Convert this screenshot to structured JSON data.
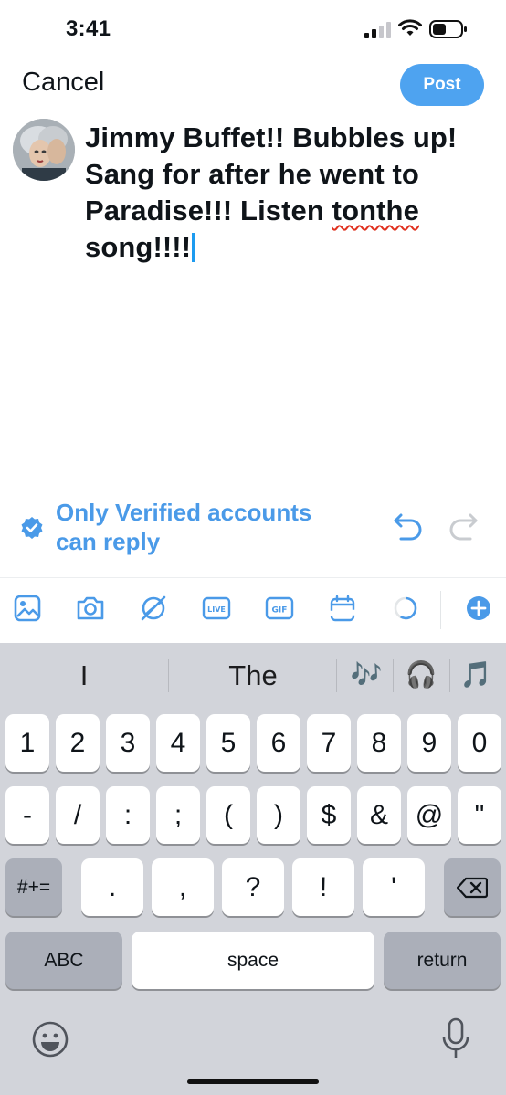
{
  "status_bar": {
    "time": "3:41"
  },
  "header": {
    "cancel_label": "Cancel",
    "post_label": "Post"
  },
  "composer": {
    "text_part1": "Jimmy Buffet!! Bubbles up! Sang for after he went to Paradise!!! Listen ",
    "misspelled_word": "tonthe",
    "text_part2": " song!!!!"
  },
  "reply_setting": {
    "label_line1": "Only Verified accounts",
    "label_line2": "can reply"
  },
  "toolbar": {
    "icons": [
      "image-icon",
      "camera-icon",
      "gif-search-icon",
      "live-icon",
      "gif-icon",
      "schedule-icon",
      "character-count-icon",
      "add-post-icon"
    ],
    "live_label": "LIVE",
    "gif_label": "GIF"
  },
  "keyboard": {
    "suggestions": [
      "I",
      "The",
      "🎶",
      "🎧",
      "🎵"
    ],
    "row1": [
      "1",
      "2",
      "3",
      "4",
      "5",
      "6",
      "7",
      "8",
      "9",
      "0"
    ],
    "row2": [
      "-",
      "/",
      ":",
      ";",
      "(",
      ")",
      "$",
      "&",
      "@",
      "\""
    ],
    "row3_shift": "#+=",
    "row3": [
      ".",
      ",",
      "?",
      "!",
      "'"
    ],
    "abc_label": "ABC",
    "space_label": "space",
    "return_label": "return"
  },
  "colors": {
    "accent": "#4ea3f0",
    "link_blue": "#4a9ae8",
    "keyboard_bg": "#d2d4da"
  }
}
